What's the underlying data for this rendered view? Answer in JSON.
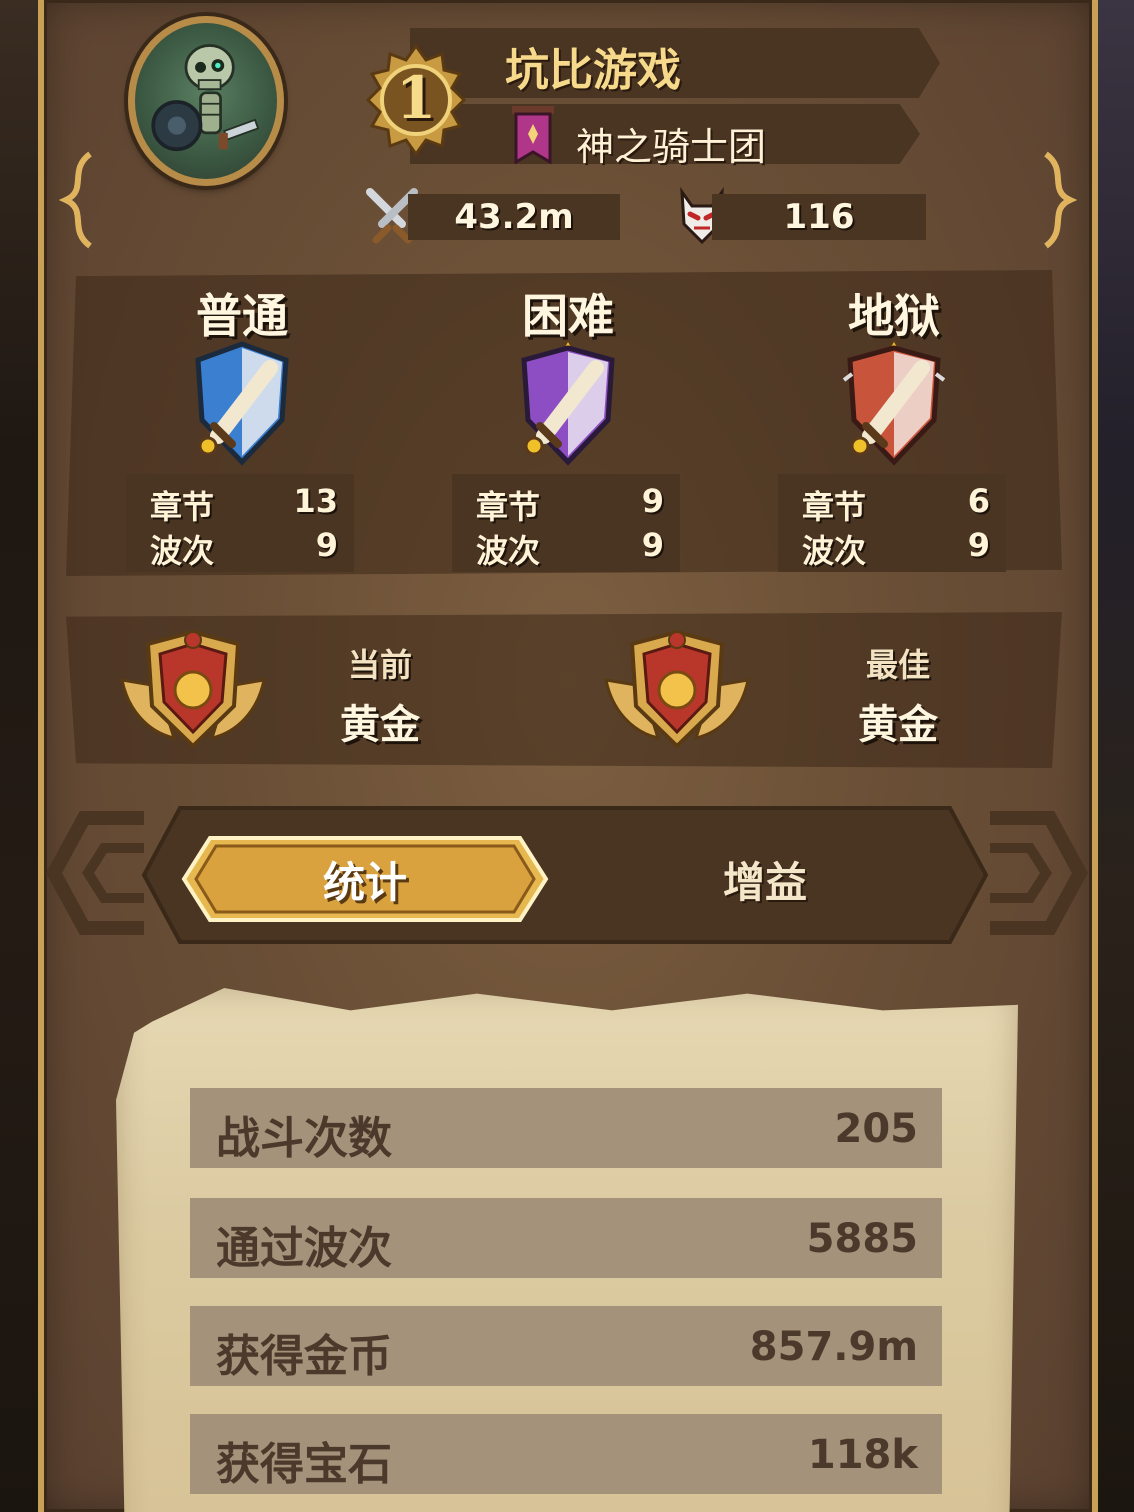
{
  "player": {
    "name": "坑比游戏",
    "rank_number": "1",
    "guild": "神之骑士团",
    "power": "43.2m",
    "kills": "116"
  },
  "difficulties": [
    {
      "title": "普通",
      "chapter_label": "章节",
      "chapter": "13",
      "wave_label": "波次",
      "wave": "9",
      "color": "#3b7fd0"
    },
    {
      "title": "困难",
      "chapter_label": "章节",
      "chapter": "9",
      "wave_label": "波次",
      "wave": "9",
      "color": "#8e4ec3"
    },
    {
      "title": "地狱",
      "chapter_label": "章节",
      "chapter": "6",
      "wave_label": "波次",
      "wave": "9",
      "color": "#c8553b"
    }
  ],
  "league": {
    "current_label": "当前",
    "current_value": "黄金",
    "best_label": "最佳",
    "best_value": "黄金"
  },
  "tabs": {
    "active": "统计",
    "inactive": "增益"
  },
  "stats": [
    {
      "label": "战斗次数",
      "value": "205"
    },
    {
      "label": "通过波次",
      "value": "5885"
    },
    {
      "label": "获得金币",
      "value": "857.9m"
    },
    {
      "label": "获得宝石",
      "value": "118k"
    }
  ],
  "icons": {
    "avatar": "skeleton-warrior-avatar",
    "rank_badge": "gold-rank-badge-icon",
    "guild_flag": "guild-flag-icon",
    "power": "crossed-swords-icon",
    "kills": "demon-mask-icon",
    "difficulty": "shield-sword-icon",
    "league": "gold-league-emblem-icon"
  },
  "colors": {
    "accent_gold": "#f6d98a",
    "panel_brown": "#6a4f36",
    "parchment": "#dccba2"
  }
}
